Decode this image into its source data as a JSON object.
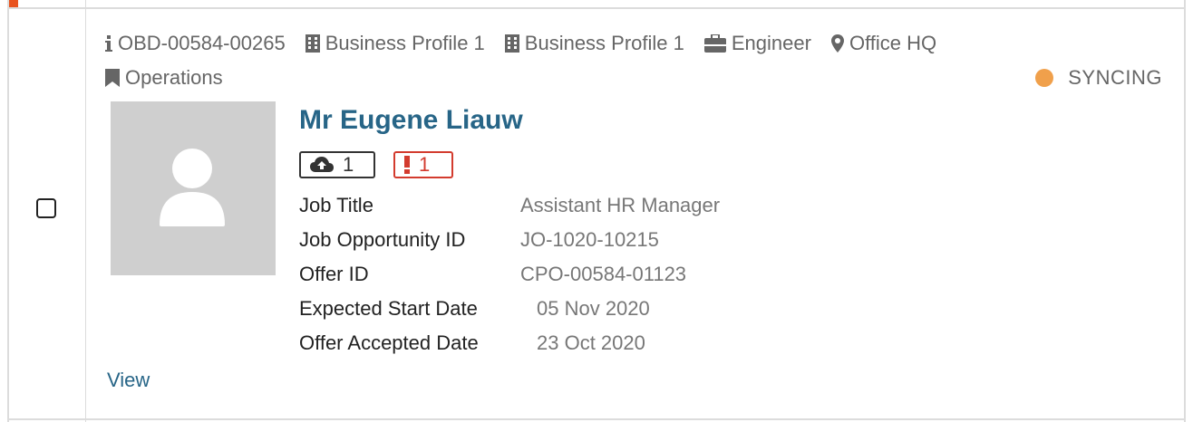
{
  "row": {
    "meta": {
      "id": "OBD-00584-00265",
      "business_profile_1": "Business Profile 1",
      "business_profile_2": "Business Profile 1",
      "role": "Engineer",
      "location": "Office HQ",
      "department": "Operations"
    },
    "status": {
      "label": "SYNCING",
      "color": "#f0a04b"
    },
    "candidate": {
      "name": "Mr Eugene Liauw",
      "sync_count": "1",
      "error_count": "1"
    },
    "details": [
      {
        "label": "Job Title",
        "value": "Assistant HR Manager"
      },
      {
        "label": "Job Opportunity ID",
        "value": "JO-1020-10215"
      },
      {
        "label": "Offer ID",
        "value": "CPO-00584-01123"
      },
      {
        "label": "Expected Start Date",
        "value": "05 Nov 2020"
      },
      {
        "label": "Offer Accepted Date",
        "value": "23 Oct 2020"
      }
    ],
    "view_label": "View"
  },
  "colors": {
    "accent": "#e8531f",
    "link": "#276587",
    "error": "#d33b2e",
    "syncing": "#f0a04b"
  },
  "icons": [
    "info-icon",
    "building-icon",
    "briefcase-icon",
    "map-marker-icon",
    "bookmark-icon",
    "cloud-upload-icon",
    "exclamation-icon",
    "user-placeholder-icon"
  ]
}
